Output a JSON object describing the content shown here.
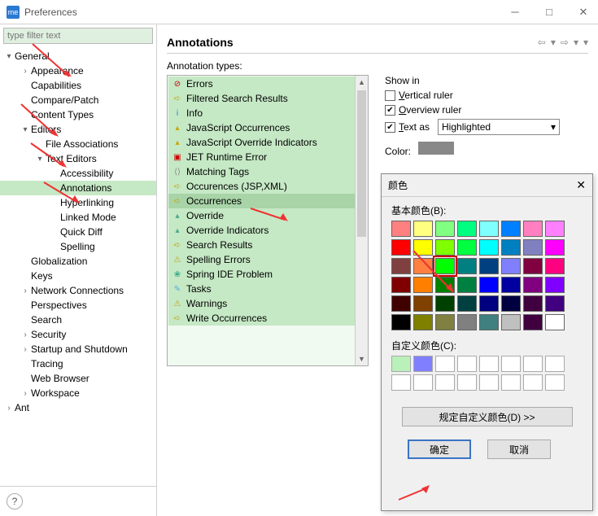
{
  "titlebar": {
    "title": "Preferences",
    "app_icon": "me"
  },
  "filter": {
    "placeholder": "type filter text"
  },
  "tree": {
    "items": [
      {
        "level": 1,
        "twist": "▾",
        "label": "General"
      },
      {
        "level": 2,
        "twist": "›",
        "label": "Appearance"
      },
      {
        "level": 2,
        "twist": "",
        "label": "Capabilities"
      },
      {
        "level": 2,
        "twist": "",
        "label": "Compare/Patch"
      },
      {
        "level": 2,
        "twist": "",
        "label": "Content Types"
      },
      {
        "level": 2,
        "twist": "▾",
        "label": "Editors"
      },
      {
        "level": 3,
        "twist": "",
        "label": "File Associations"
      },
      {
        "level": 3,
        "twist": "▾",
        "label": "Text Editors"
      },
      {
        "level": 4,
        "twist": "",
        "label": "Accessibility"
      },
      {
        "level": 4,
        "twist": "",
        "label": "Annotations",
        "selected": true
      },
      {
        "level": 4,
        "twist": "",
        "label": "Hyperlinking"
      },
      {
        "level": 4,
        "twist": "",
        "label": "Linked Mode"
      },
      {
        "level": 4,
        "twist": "",
        "label": "Quick Diff"
      },
      {
        "level": 4,
        "twist": "",
        "label": "Spelling"
      },
      {
        "level": 2,
        "twist": "",
        "label": "Globalization"
      },
      {
        "level": 2,
        "twist": "",
        "label": "Keys"
      },
      {
        "level": 2,
        "twist": "›",
        "label": "Network Connections"
      },
      {
        "level": 2,
        "twist": "",
        "label": "Perspectives"
      },
      {
        "level": 2,
        "twist": "",
        "label": "Search"
      },
      {
        "level": 2,
        "twist": "›",
        "label": "Security"
      },
      {
        "level": 2,
        "twist": "›",
        "label": "Startup and Shutdown"
      },
      {
        "level": 2,
        "twist": "",
        "label": "Tracing"
      },
      {
        "level": 2,
        "twist": "",
        "label": "Web Browser"
      },
      {
        "level": 2,
        "twist": "›",
        "label": "Workspace"
      },
      {
        "level": 1,
        "twist": "›",
        "label": "Ant"
      }
    ]
  },
  "content": {
    "title": "Annotations",
    "section_label": "Annotation types:",
    "types": [
      {
        "icon": "⊘",
        "color": "#c00",
        "label": "Errors"
      },
      {
        "icon": "➪",
        "color": "#caa400",
        "label": "Filtered Search Results"
      },
      {
        "icon": "i",
        "color": "#2a7ad2",
        "label": "Info"
      },
      {
        "icon": "▴",
        "color": "#caa400",
        "label": "JavaScript Occurrences"
      },
      {
        "icon": "▴",
        "color": "#caa400",
        "label": "JavaScript Override Indicators"
      },
      {
        "icon": "▣",
        "color": "#c00",
        "label": "JET Runtime Error"
      },
      {
        "icon": "⟨⟩",
        "color": "#888",
        "label": "Matching Tags"
      },
      {
        "icon": "➪",
        "color": "#caa400",
        "label": "Occurences (JSP,XML)"
      },
      {
        "icon": "➪",
        "color": "#caa400",
        "label": "Occurrences",
        "selected": true
      },
      {
        "icon": "▴",
        "color": "#4a8",
        "label": "Override"
      },
      {
        "icon": "▴",
        "color": "#4a8",
        "label": "Override Indicators"
      },
      {
        "icon": "➪",
        "color": "#caa400",
        "label": "Search Results"
      },
      {
        "icon": "⚠",
        "color": "#caa400",
        "label": "Spelling Errors"
      },
      {
        "icon": "❀",
        "color": "#3a8",
        "label": "Spring IDE Problem"
      },
      {
        "icon": "✎",
        "color": "#5ad",
        "label": "Tasks"
      },
      {
        "icon": "⚠",
        "color": "#caa400",
        "label": "Warnings"
      },
      {
        "icon": "➪",
        "color": "#caa400",
        "label": "Write Occurrences"
      }
    ],
    "options": {
      "show_in": "Show in",
      "vertical_ruler": "Vertical ruler",
      "overview_ruler": "Overview ruler",
      "text_as": "Text as",
      "text_as_value": "Highlighted",
      "color_label": "Color:"
    }
  },
  "color_dialog": {
    "title": "颜色",
    "basic_label": "基本颜色(B):",
    "custom_label": "自定义颜色(C):",
    "define_btn": "规定自定义颜色(D) >>",
    "ok": "确定",
    "cancel": "取消",
    "basic_colors": [
      "#ff8080",
      "#ffff80",
      "#80ff80",
      "#00ff80",
      "#80ffff",
      "#0080ff",
      "#ff80c0",
      "#ff80ff",
      "#ff0000",
      "#ffff00",
      "#80ff00",
      "#00ff40",
      "#00ffff",
      "#0080c0",
      "#8080c0",
      "#ff00ff",
      "#804040",
      "#ff8040",
      "#00ff00",
      "#008080",
      "#004080",
      "#8080ff",
      "#800040",
      "#ff0080",
      "#800000",
      "#ff8000",
      "#008000",
      "#008040",
      "#0000ff",
      "#0000a0",
      "#800080",
      "#8000ff",
      "#400000",
      "#804000",
      "#004000",
      "#004040",
      "#000080",
      "#000040",
      "#400040",
      "#400080",
      "#000000",
      "#808000",
      "#808040",
      "#808080",
      "#408080",
      "#c0c0c0",
      "#400040",
      "#ffffff"
    ],
    "selected_basic_index": 18,
    "custom_colors": [
      "#baf0ba",
      "#8080ff",
      "#ffffff",
      "#ffffff",
      "#ffffff",
      "#ffffff",
      "#ffffff",
      "#ffffff",
      "#ffffff",
      "#ffffff",
      "#ffffff",
      "#ffffff",
      "#ffffff",
      "#ffffff",
      "#ffffff",
      "#ffffff"
    ]
  }
}
